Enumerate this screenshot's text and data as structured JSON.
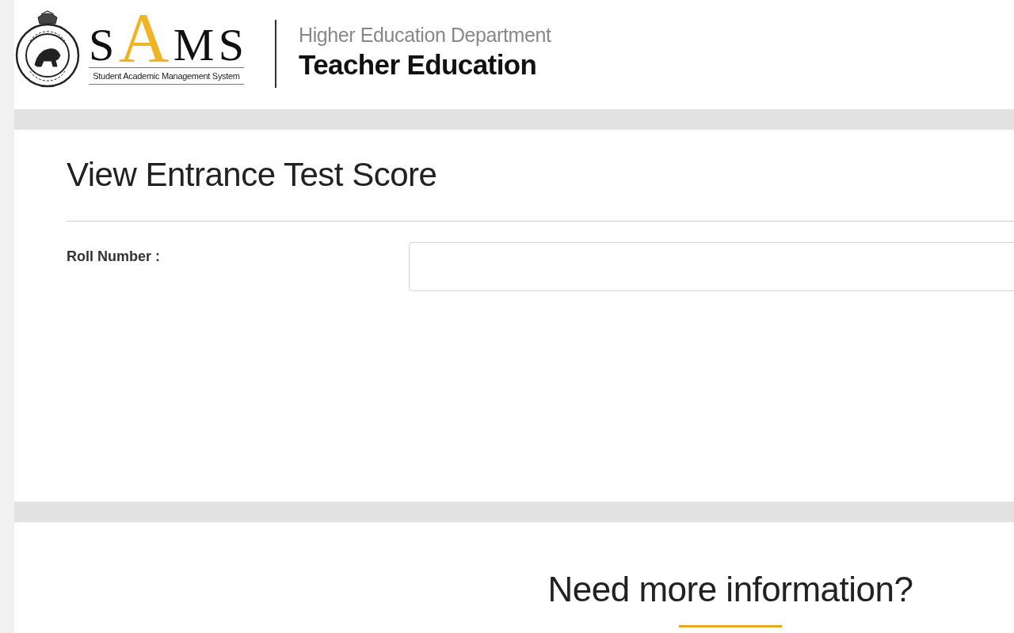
{
  "header": {
    "logo": {
      "parts": [
        {
          "text": "S",
          "accent": false
        },
        {
          "text": "A",
          "accent": true
        },
        {
          "text": "M",
          "accent": false
        },
        {
          "text": "S",
          "accent": false
        }
      ],
      "tagline": "Student Academic Management System"
    },
    "department": "Higher Education Department",
    "portal": "Teacher Education"
  },
  "form": {
    "title": "View Entrance Test Score",
    "fields": [
      {
        "kind": "text",
        "label": "Roll Number :"
      }
    ]
  },
  "footer": {
    "title": "Need more information?"
  }
}
